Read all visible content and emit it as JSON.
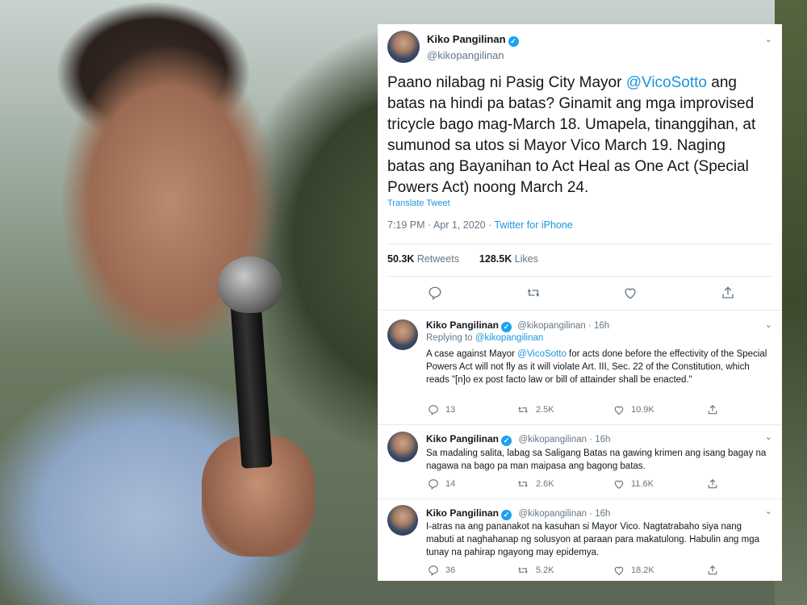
{
  "main_tweet": {
    "name": "Kiko Pangilinan",
    "handle": "@kikopangilinan",
    "text_before": "Paano nilabag ni Pasig City Mayor ",
    "mention": "@VicoSotto",
    "text_after": " ang batas na hindi pa batas? Ginamit ang mga improvised tricycle bago mag-March 18. Umapela, tinanggihan, at sumunod sa utos si Mayor Vico March 19. Naging batas ang Bayanihan to Act Heal as One Act (Special Powers Act) noong March 24.",
    "translate_label": "Translate Tweet",
    "timestamp": "7:19 PM · Apr 1, 2020 · ",
    "source": "Twitter for iPhone",
    "retweets_count": "50.3K",
    "retweets_label": " Retweets",
    "likes_count": "128.5K",
    "likes_label": " Likes"
  },
  "replies": [
    {
      "name": "Kiko Pangilinan",
      "handle": "@kikopangilinan · 16h",
      "replying_prefix": "Replying to ",
      "replying_to": "@kikopangilinan",
      "text_before": "A case against Mayor ",
      "mention": "@VicoSotto",
      "text_after": " for acts done before the effectivity of the Special Powers Act will not fly as it will violate Art. III, Sec. 22 of the Constitution, which reads \"[n]o ex post facto law or bill of attainder shall be enacted.\"",
      "replies": "13",
      "retweets": "2.5K",
      "likes": "10.9K"
    },
    {
      "name": "Kiko Pangilinan",
      "handle": "@kikopangilinan · 16h",
      "text": "Sa madaling salita, labag sa Saligang Batas na gawing krimen ang isang bagay na nagawa na bago pa man maipasa ang bagong batas.",
      "replies": "14",
      "retweets": "2.6K",
      "likes": "11.6K"
    },
    {
      "name": "Kiko Pangilinan",
      "handle": "@kikopangilinan · 16h",
      "text": "I-atras na ang pananakot na kasuhan si Mayor Vico. Nagtatrabaho siya nang mabuti at naghahanap ng solusyon at paraan para makatulong. Habulin ang mga tunay na pahirap ngayong may epidemya.",
      "replies": "36",
      "retweets": "5.2K",
      "likes": "18.2K"
    }
  ],
  "icons": {
    "reply": "reply-icon",
    "retweet": "retweet-icon",
    "like": "heart-icon",
    "share": "share-icon",
    "verified": "verified-badge-icon",
    "more": "chevron-down-icon"
  },
  "colors": {
    "link": "#1b95e0",
    "verified": "#1da1f2",
    "text": "#14171a",
    "secondary": "#657786"
  }
}
